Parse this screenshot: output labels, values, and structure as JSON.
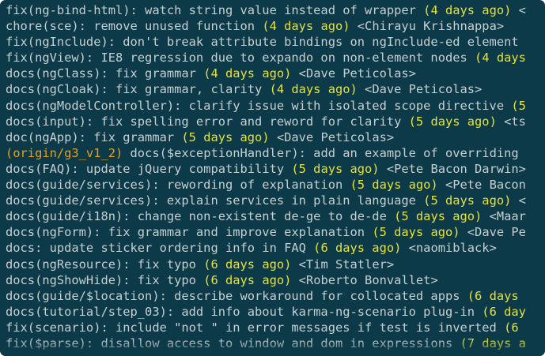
{
  "colors": {
    "background": "#0c3a49",
    "text": "#c7d0d1",
    "date": "#e6e238",
    "ref": "#e6a11c"
  },
  "log_lines": [
    {
      "ref": "",
      "message": "fix(ng-bind-html): watch string value instead of wrapper ",
      "date": "(4 days ago)",
      "author": " <"
    },
    {
      "ref": "",
      "message": "chore(sce): remove unused function ",
      "date": "(4 days ago)",
      "author": " <Chirayu Krishnappa>"
    },
    {
      "ref": "",
      "message": "fix(ngInclude): don't break attribute bindings on ngInclude-ed element",
      "date": "",
      "author": ""
    },
    {
      "ref": "",
      "message": "fix(ngView): IE8 regression due to expando on non-element nodes ",
      "date": "(4 days",
      "author": ""
    },
    {
      "ref": "",
      "message": "docs(ngClass): fix grammar ",
      "date": "(4 days ago)",
      "author": " <Dave Peticolas>"
    },
    {
      "ref": "",
      "message": "docs(ngCloak): fix grammar, clarity ",
      "date": "(4 days ago)",
      "author": " <Dave Peticolas>"
    },
    {
      "ref": "",
      "message": "docs(ngModelController): clarify issue with isolated scope directive ",
      "date": "(5",
      "author": ""
    },
    {
      "ref": "",
      "message": "docs(input): fix spelling error and reword for clarity ",
      "date": "(5 days ago)",
      "author": " <ts"
    },
    {
      "ref": "",
      "message": "doc(ngApp): fix grammar ",
      "date": "(5 days ago)",
      "author": " <Dave Peticolas>"
    },
    {
      "ref": "(origin/g3_v1_2)",
      "message": " docs($exceptionHandler): add an example of overriding",
      "date": "",
      "author": ""
    },
    {
      "ref": "",
      "message": "docs(FAQ): update jQuery compatibility ",
      "date": "(5 days ago)",
      "author": " <Pete Bacon Darwin>"
    },
    {
      "ref": "",
      "message": "docs(guide/services): rewording of explanation ",
      "date": "(5 days ago)",
      "author": " <Pete Bacon"
    },
    {
      "ref": "",
      "message": "docs(guide/services): explain services in plain language ",
      "date": "(5 days ago)",
      "author": " <"
    },
    {
      "ref": "",
      "message": "docs(guide/i18n): change non-existent de-ge to de-de ",
      "date": "(5 days ago)",
      "author": " <Maar"
    },
    {
      "ref": "",
      "message": "docs(ngForm): fix grammar and improve explanation ",
      "date": "(5 days ago)",
      "author": " <Dave Pe"
    },
    {
      "ref": "",
      "message": "docs: update sticker ordering info in FAQ ",
      "date": "(6 days ago)",
      "author": " <naomiblack>"
    },
    {
      "ref": "",
      "message": "docs(ngResource): fix typo ",
      "date": "(6 days ago)",
      "author": " <Tim Statler>"
    },
    {
      "ref": "",
      "message": "docs(ngShowHide): fix typo ",
      "date": "(6 days ago)",
      "author": " <Roberto Bonvallet>"
    },
    {
      "ref": "",
      "message": "docs(guide/$location): describe workaround for collocated apps ",
      "date": "(6 days",
      "author": ""
    },
    {
      "ref": "",
      "message": "docs(tutorial/step_03): add info about karma-ng-scenario plug-in ",
      "date": "(6 day",
      "author": ""
    },
    {
      "ref": "",
      "message": "fix(scenario): include \"not \" in error messages if test is inverted ",
      "date": "(6",
      "author": ""
    },
    {
      "ref": "",
      "message": "fix($parse): disallow access to window and dom in expressions ",
      "date": "(7 days a",
      "author": ""
    }
  ]
}
